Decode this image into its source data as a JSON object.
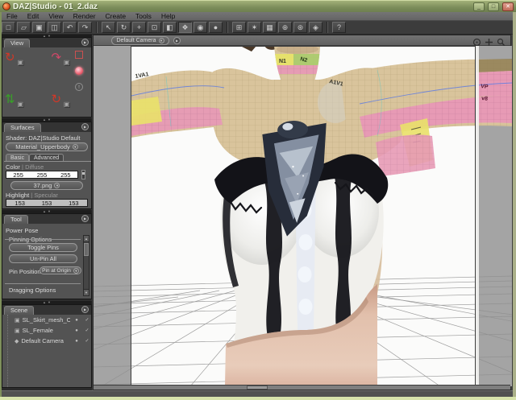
{
  "window": {
    "title": "DAZ|Studio - 01_2.daz",
    "minimize_glyph": "_",
    "maximize_glyph": "□",
    "close_glyph": "✕"
  },
  "menu": {
    "items": [
      {
        "label": "File"
      },
      {
        "label": "Edit"
      },
      {
        "label": "View"
      },
      {
        "label": "Render"
      },
      {
        "label": "Create"
      },
      {
        "label": "Tools"
      },
      {
        "label": "Help"
      }
    ]
  },
  "toolbar": {
    "buttons": [
      {
        "name": "new-file",
        "glyph": "□"
      },
      {
        "name": "open-file",
        "glyph": "▱"
      },
      {
        "name": "save-file",
        "glyph": "▣"
      },
      {
        "name": "duplicate",
        "glyph": "◫"
      },
      {
        "name": "undo",
        "glyph": "↶"
      },
      {
        "name": "redo",
        "glyph": "↷"
      },
      {
        "name": "select-tool",
        "glyph": "↖"
      },
      {
        "name": "rotate-tool",
        "glyph": "↻"
      },
      {
        "name": "translate-tool",
        "glyph": "+"
      },
      {
        "name": "scale-tool",
        "glyph": "⊡"
      },
      {
        "name": "surface-selection-tool",
        "glyph": "◧"
      },
      {
        "name": "node-selection-tool",
        "glyph": "❖"
      },
      {
        "name": "spot-render-tool",
        "glyph": "◉"
      },
      {
        "name": "render-tool",
        "glyph": "●"
      },
      {
        "name": "create-null",
        "glyph": "⊞"
      },
      {
        "name": "create-light",
        "glyph": "✶"
      },
      {
        "name": "create-camera",
        "glyph": "▦"
      },
      {
        "name": "create-dformer",
        "glyph": "⊕"
      },
      {
        "name": "create-prop",
        "glyph": "⊛"
      },
      {
        "name": "create-figure",
        "glyph": "◈"
      },
      {
        "name": "help",
        "glyph": "?"
      }
    ]
  },
  "ui": {
    "dropdown_arrow": "▾",
    "flyout_arrow": "▶",
    "splitter_up": "▲",
    "splitter_down": "▼",
    "scroll_up": "▲",
    "scroll_down": "▼",
    "check": "✓",
    "eye": "●",
    "camera_glyph": "▣",
    "up_arrow": "↑",
    "tree_tick": "·"
  },
  "panels": {
    "view": {
      "tab": "View",
      "icons": [
        {
          "name": "orbit-view",
          "glyph": "↻"
        },
        {
          "name": "bank-view",
          "glyph": "↷"
        },
        {
          "name": "orbit-alt-view",
          "glyph": "↺"
        },
        {
          "name": "pan-view",
          "glyph": "⇅"
        },
        {
          "name": "rotate-free-view",
          "glyph": "↻"
        },
        {
          "name": "dolly-view",
          "glyph": "⇄"
        }
      ]
    },
    "surfaces": {
      "tab": "Surfaces",
      "shader_label": "Shader:",
      "shader_value": "DAZ|Studio Default",
      "material_dropdown": "Material_Upperbody",
      "subtabs": [
        {
          "label": "Basic"
        },
        {
          "label": "Advanced"
        }
      ],
      "color_label": "Color",
      "divider": "|",
      "color_type": "Diffuse",
      "color_values": [
        {
          "v": "255"
        },
        {
          "v": "255"
        },
        {
          "v": "255"
        }
      ],
      "texture_dropdown": "37.png",
      "highlight_label": "Highlight",
      "highlight_type": "Specular",
      "highlight_values": [
        {
          "v": "153"
        },
        {
          "v": "153"
        },
        {
          "v": "153"
        }
      ]
    },
    "tool": {
      "tab": "Tool",
      "active_tool": "Power Pose",
      "pinning_group": "Pinning Options",
      "buttons": [
        {
          "label": "Toggle Pins"
        },
        {
          "label": "Un-Pin All"
        }
      ],
      "pin_position_label": "Pin Position:",
      "pin_position_value": "Pin at Origin",
      "dragging_group": "Dragging Options"
    },
    "scene": {
      "tab": "Scene",
      "items": [
        {
          "label": "SL_Skirt_mesh_OBJ",
          "icon": "▣"
        },
        {
          "label": "SL_Female",
          "icon": "▣"
        },
        {
          "label": "Default Camera",
          "icon": "◆"
        }
      ]
    }
  },
  "viewport": {
    "camera_dropdown": "Default Camera",
    "texture_labels": {
      "left_arm": "1VA1",
      "neck_left": "N1",
      "neck_right": "N2",
      "right_shoulder": "A1V1",
      "wrist_top": "VP",
      "wrist_bottom": "v8"
    }
  },
  "colors": {
    "titlebar": "#8ea06a",
    "close_button": "#c97f72",
    "uv_skin": "#d9c49c",
    "uv_pink": "#e79ab5",
    "uv_yellow": "#e9e16b",
    "uv_green": "#aacb6e",
    "lace_black": "#17171c",
    "corset_white": "#f1f0ec",
    "skirt": "#dcb5a2",
    "viewport_gray": "#a4a4a4"
  }
}
